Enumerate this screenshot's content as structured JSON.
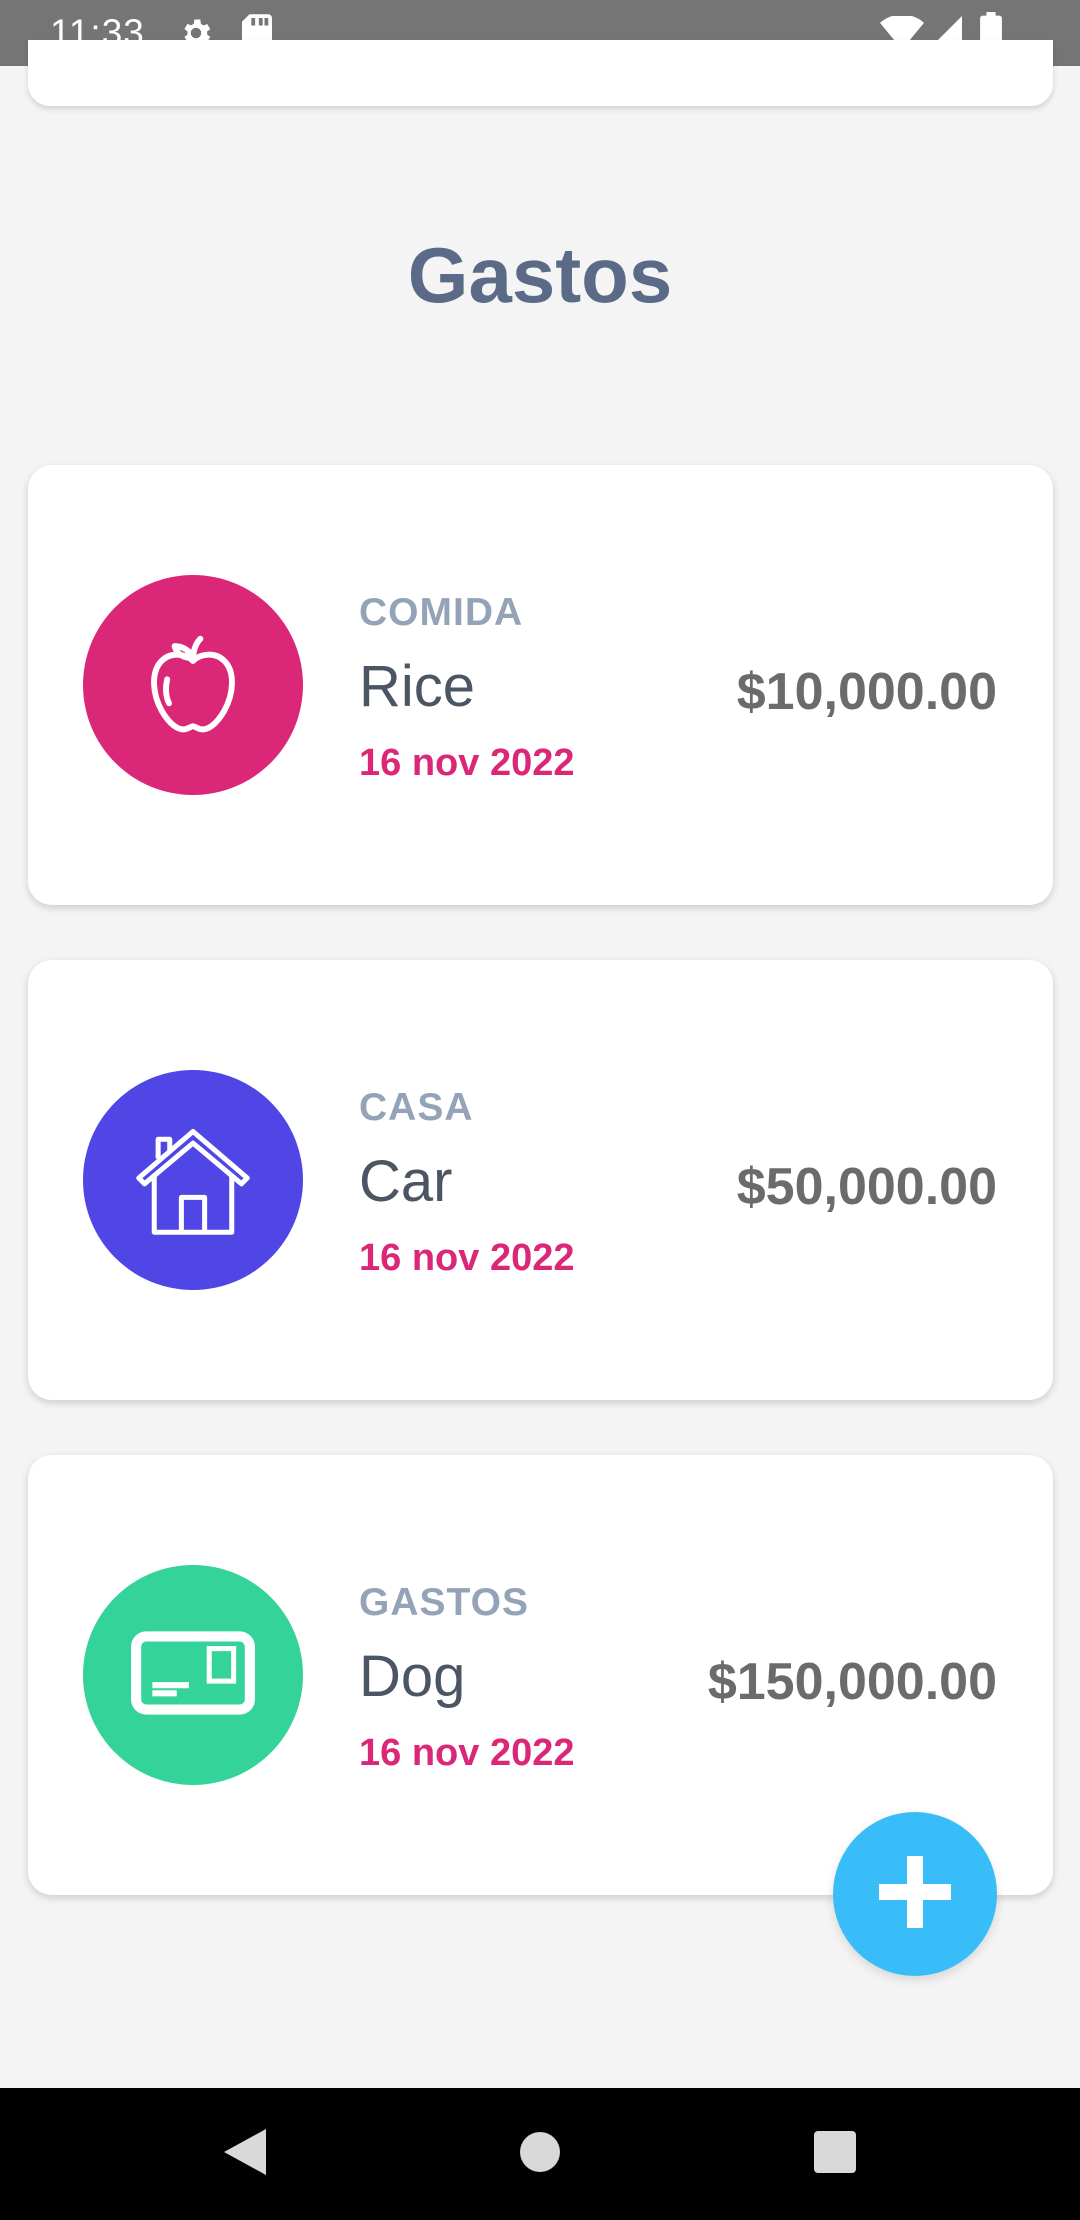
{
  "status_bar": {
    "time": "11:33",
    "icons": [
      "gear-icon",
      "sd-card-icon",
      "wifi-icon",
      "signal-icon",
      "battery-icon"
    ]
  },
  "page": {
    "title": "Gastos"
  },
  "expenses": [
    {
      "category": "COMIDA",
      "name": "Rice",
      "date": "16 nov 2022",
      "amount": "$10,000.00",
      "icon": "apple-icon",
      "color": "#db2777"
    },
    {
      "category": "CASA",
      "name": "Car",
      "date": "16 nov 2022",
      "amount": "$50,000.00",
      "icon": "house-icon",
      "color": "#4f46e5"
    },
    {
      "category": "GASTOS",
      "name": "Dog",
      "date": "16 nov 2022",
      "amount": "$150,000.00",
      "icon": "card-icon",
      "color": "#34d399"
    }
  ],
  "fab": {
    "icon": "plus-icon",
    "color": "#38bdf8"
  },
  "nav_bar": {
    "icons": [
      "back-icon",
      "home-icon",
      "recents-icon"
    ]
  }
}
